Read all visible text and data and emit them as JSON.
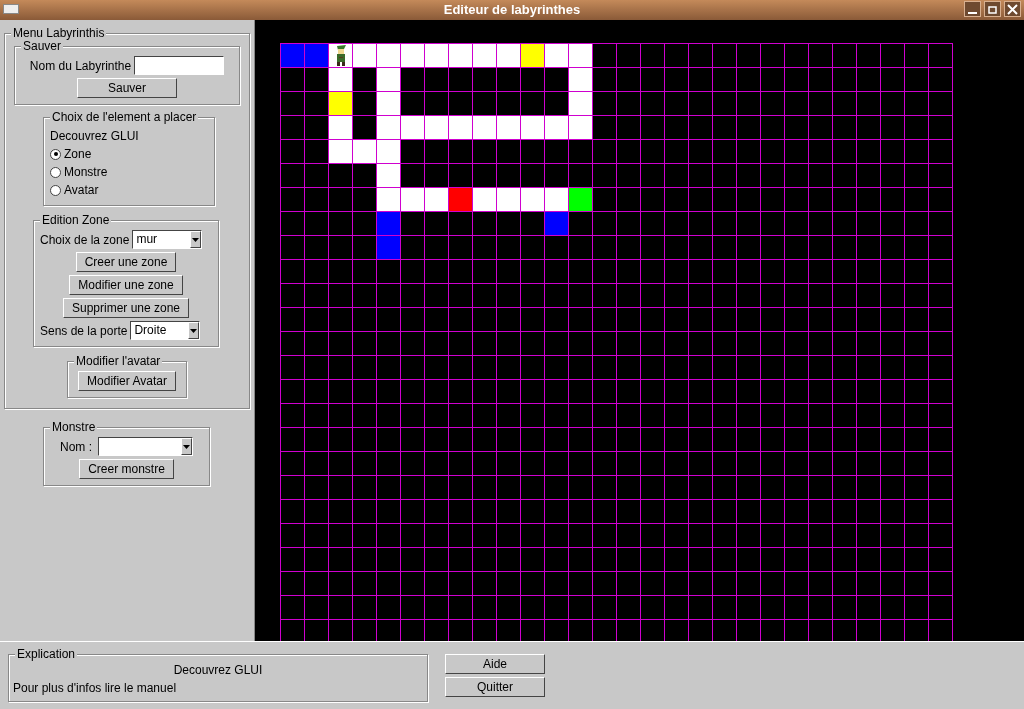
{
  "window": {
    "title": "Editeur de labyrinthes"
  },
  "menu": {
    "title": "Menu Labyrinthis",
    "save": {
      "title": "Sauver",
      "name_label": "Nom du Labyrinthe",
      "button": "Sauver"
    },
    "element_choice": {
      "title": "Choix de l'element a placer",
      "subtitle": "Decouvrez GLUI",
      "options": [
        {
          "label": "Zone",
          "selected": true
        },
        {
          "label": "Monstre",
          "selected": false
        },
        {
          "label": "Avatar",
          "selected": false
        }
      ]
    },
    "zone_edit": {
      "title": "Edition Zone",
      "zone_label": "Choix de la zone",
      "zone_value": "mur",
      "buttons": [
        "Creer une zone",
        "Modifier une zone",
        "Supprimer une zone"
      ],
      "door_label": "Sens de la porte",
      "door_value": "Droite"
    },
    "avatar": {
      "title": "Modifier l'avatar",
      "button": "Modifier Avatar"
    }
  },
  "monster": {
    "title": "Monstre",
    "name_label": "Nom :",
    "button": "Creer monstre"
  },
  "maze": {
    "rows": [
      [
        {
          "kind": "tile",
          "color": "#0000ff"
        },
        {
          "kind": "tile",
          "color": "#0000ff"
        },
        {
          "kind": "avatar",
          "color": "#ffffff"
        },
        {
          "kind": "tile",
          "color": "#ffffff"
        },
        {
          "kind": "tile",
          "color": "#ffffff"
        },
        {
          "kind": "tile",
          "color": "#ffffff"
        },
        {
          "kind": "tile",
          "color": "#ffffff"
        },
        {
          "kind": "tile",
          "color": "#ffffff"
        },
        {
          "kind": "tile",
          "color": "#ffffff"
        },
        {
          "kind": "tile",
          "color": "#ffffff"
        },
        {
          "kind": "tile",
          "color": "#ffff00"
        },
        {
          "kind": "tile",
          "color": "#ffffff"
        },
        {
          "kind": "tile",
          "color": "#ffffff"
        }
      ],
      [
        {
          "kind": "empty"
        },
        {
          "kind": "empty"
        },
        {
          "kind": "tile",
          "color": "#ffffff"
        },
        {
          "kind": "empty"
        },
        {
          "kind": "tile",
          "color": "#ffffff"
        },
        {
          "kind": "empty"
        },
        {
          "kind": "empty"
        },
        {
          "kind": "empty"
        },
        {
          "kind": "empty"
        },
        {
          "kind": "empty"
        },
        {
          "kind": "empty"
        },
        {
          "kind": "empty"
        },
        {
          "kind": "tile",
          "color": "#ffffff"
        }
      ],
      [
        {
          "kind": "empty"
        },
        {
          "kind": "empty"
        },
        {
          "kind": "tile",
          "color": "#ffff00"
        },
        {
          "kind": "empty"
        },
        {
          "kind": "tile",
          "color": "#ffffff"
        },
        {
          "kind": "empty"
        },
        {
          "kind": "empty"
        },
        {
          "kind": "empty"
        },
        {
          "kind": "empty"
        },
        {
          "kind": "empty"
        },
        {
          "kind": "empty"
        },
        {
          "kind": "empty"
        },
        {
          "kind": "tile",
          "color": "#ffffff"
        }
      ],
      [
        {
          "kind": "empty"
        },
        {
          "kind": "empty"
        },
        {
          "kind": "tile",
          "color": "#ffffff"
        },
        {
          "kind": "empty"
        },
        {
          "kind": "tile",
          "color": "#ffffff"
        },
        {
          "kind": "tile",
          "color": "#ffffff"
        },
        {
          "kind": "tile",
          "color": "#ffffff"
        },
        {
          "kind": "tile",
          "color": "#ffffff"
        },
        {
          "kind": "tile",
          "color": "#ffffff"
        },
        {
          "kind": "tile",
          "color": "#ffffff"
        },
        {
          "kind": "tile",
          "color": "#ffffff"
        },
        {
          "kind": "tile",
          "color": "#ffffff"
        },
        {
          "kind": "tile",
          "color": "#ffffff"
        }
      ],
      [
        {
          "kind": "empty"
        },
        {
          "kind": "empty"
        },
        {
          "kind": "tile",
          "color": "#ffffff"
        },
        {
          "kind": "tile",
          "color": "#ffffff"
        },
        {
          "kind": "tile",
          "color": "#ffffff"
        }
      ],
      [
        {
          "kind": "empty"
        },
        {
          "kind": "empty"
        },
        {
          "kind": "empty"
        },
        {
          "kind": "empty"
        },
        {
          "kind": "tile",
          "color": "#ffffff"
        }
      ],
      [
        {
          "kind": "empty"
        },
        {
          "kind": "empty"
        },
        {
          "kind": "empty"
        },
        {
          "kind": "empty"
        },
        {
          "kind": "tile",
          "color": "#ffffff"
        },
        {
          "kind": "tile",
          "color": "#ffffff"
        },
        {
          "kind": "tile",
          "color": "#ffffff"
        },
        {
          "kind": "tile",
          "color": "#ff0000"
        },
        {
          "kind": "tile",
          "color": "#ffffff"
        },
        {
          "kind": "tile",
          "color": "#ffffff"
        },
        {
          "kind": "tile",
          "color": "#ffffff"
        },
        {
          "kind": "tile",
          "color": "#ffffff"
        },
        {
          "kind": "tile",
          "color": "#00ff00"
        }
      ],
      [
        {
          "kind": "empty"
        },
        {
          "kind": "empty"
        },
        {
          "kind": "empty"
        },
        {
          "kind": "empty"
        },
        {
          "kind": "tile",
          "color": "#0000ff"
        },
        {
          "kind": "empty"
        },
        {
          "kind": "empty"
        },
        {
          "kind": "empty"
        },
        {
          "kind": "empty"
        },
        {
          "kind": "empty"
        },
        {
          "kind": "empty"
        },
        {
          "kind": "tile",
          "color": "#0000ff"
        }
      ],
      [
        {
          "kind": "empty"
        },
        {
          "kind": "empty"
        },
        {
          "kind": "empty"
        },
        {
          "kind": "empty"
        },
        {
          "kind": "tile",
          "color": "#0000ff"
        }
      ]
    ]
  },
  "explanation": {
    "title": "Explication",
    "line_1": "Decouvrez GLUI",
    "line_2": "Pour plus d'infos lire le manuel"
  },
  "buttons": [
    "Aide",
    "Quitter"
  ]
}
